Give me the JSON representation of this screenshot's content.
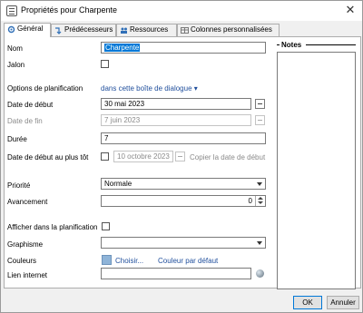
{
  "window": {
    "title": "Propriétés pour Charpente"
  },
  "tabs": [
    {
      "label": "Général",
      "icon": "gear-icon"
    },
    {
      "label": "Prédécesseurs",
      "icon": "link-arrow-icon"
    },
    {
      "label": "Ressources",
      "icon": "people-icon"
    },
    {
      "label": "Colonnes personnalisées",
      "icon": "table-icon"
    }
  ],
  "form": {
    "name_label": "Nom",
    "name_value": "Charpente",
    "jalon_label": "Jalon",
    "planning_options_label": "Options de planification",
    "planning_options_link": "dans cette boîte de dialogue",
    "start_date_label": "Date de début",
    "start_date_value": "30 mai 2023",
    "end_date_label": "Date de fin",
    "end_date_value": "7 juin 2023",
    "duration_label": "Durée",
    "duration_value": "7",
    "earliest_start_label": "Date de début au plus tôt",
    "earliest_start_value": "10 octobre 2023",
    "copy_start_date_label": "Copier la date de début",
    "priority_label": "Priorité",
    "priority_value": "Normale",
    "progress_label": "Avancement",
    "progress_value": "0",
    "show_in_plan_label": "Afficher dans la planification",
    "graphics_label": "Graphisme",
    "graphics_value": "",
    "colors_label": "Couleurs",
    "colors_choose": "Choisir...",
    "colors_default": "Couleur par défaut",
    "colors_swatch": "#8fb4d8",
    "link_label": "Lien internet",
    "link_value": ""
  },
  "notes": {
    "label": "Notes",
    "value": ""
  },
  "footer": {
    "ok_label": "OK",
    "cancel_label": "Annuler"
  }
}
